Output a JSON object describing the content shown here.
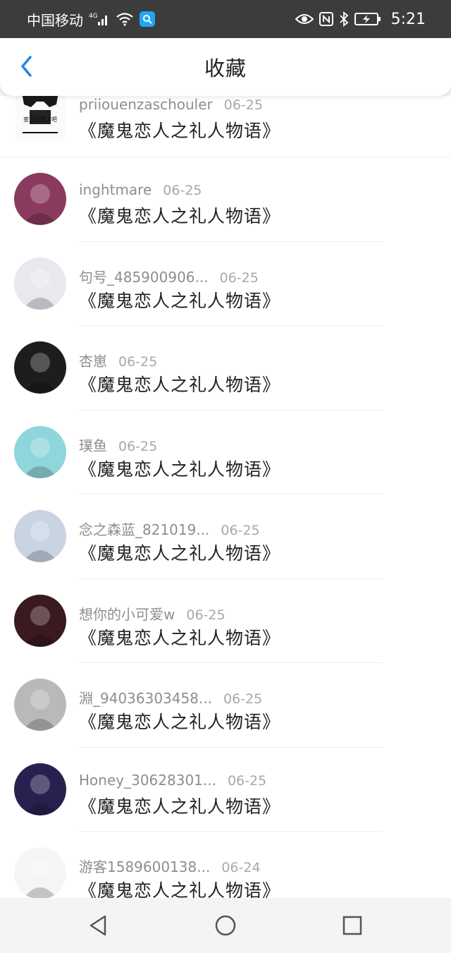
{
  "status_bar": {
    "carrier": "中国移动",
    "network": "4G",
    "time": "5:21"
  },
  "header": {
    "title": "收藏",
    "back_icon": "chevron-left-icon"
  },
  "colors": {
    "accent": "#1e88e5",
    "status_bg": "#3c3c3c",
    "text_main": "#222222",
    "text_meta": "#9a9a9a"
  },
  "list": {
    "first_item": {
      "user": "priiouenzaschouler",
      "date": "06-25",
      "title": "《魔鬼恋人之礼人物语》",
      "avatar_text": "变了就算了吧"
    },
    "items": [
      {
        "user": "inghtmare",
        "date": "06-25",
        "title": "《魔鬼恋人之礼人物语》",
        "avatar": "#8a3a5e"
      },
      {
        "user": "句号_485900906...",
        "date": "06-25",
        "title": "《魔鬼恋人之礼人物语》",
        "avatar": "#e8e8ef"
      },
      {
        "user": "杏崽",
        "date": "06-25",
        "title": "《魔鬼恋人之礼人物语》",
        "avatar": "#1d1d1d"
      },
      {
        "user": "璞鱼",
        "date": "06-25",
        "title": "《魔鬼恋人之礼人物语》",
        "avatar": "#8fd6dc"
      },
      {
        "user": "念之森蓝_821019...",
        "date": "06-25",
        "title": "《魔鬼恋人之礼人物语》",
        "avatar": "#c9d4e2"
      },
      {
        "user": "想你的小可爱w",
        "date": "06-25",
        "title": "《魔鬼恋人之礼人物语》",
        "avatar": "#3a1a1e"
      },
      {
        "user": "淵_94036303458...",
        "date": "06-25",
        "title": "《魔鬼恋人之礼人物语》",
        "avatar": "#b9b9b9"
      },
      {
        "user": "Honey_30628301...",
        "date": "06-25",
        "title": "《魔鬼恋人之礼人物语》",
        "avatar": "#2a2050"
      },
      {
        "user": "游客1589600138...",
        "date": "06-24",
        "title": "《魔鬼恋人之礼人物语》",
        "avatar": "#f5f5f5"
      }
    ]
  },
  "nav": {
    "back": "triangle-back-icon",
    "home": "circle-home-icon",
    "recents": "square-recents-icon"
  }
}
